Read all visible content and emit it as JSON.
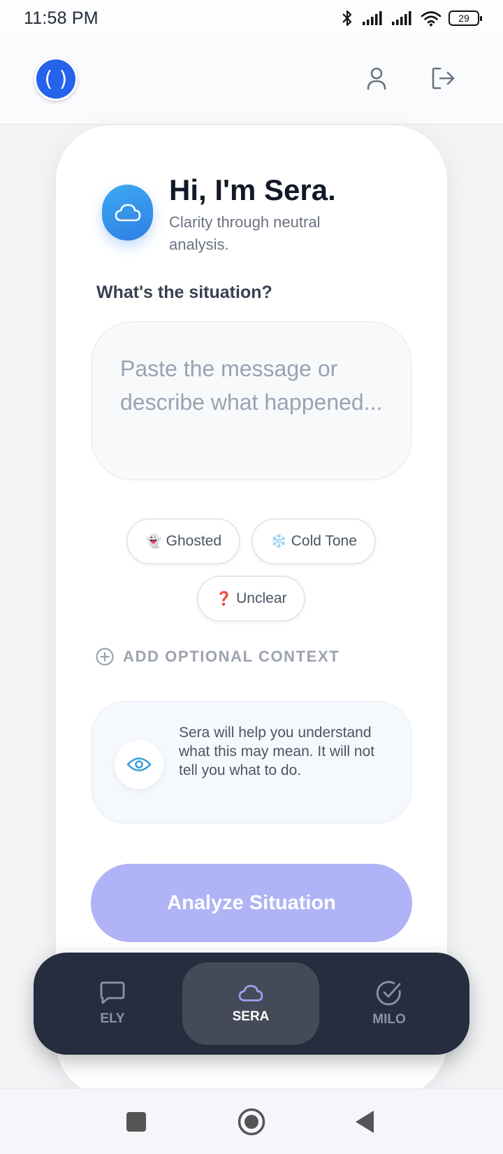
{
  "status_bar": {
    "time": "11:58 PM",
    "battery": "29",
    "icons": [
      "bluetooth-icon",
      "signal-icon",
      "signal-icon",
      "wifi-icon",
      "battery-icon"
    ]
  },
  "header": {
    "logo_text": "( )",
    "profile_icon": "user-icon",
    "logout_icon": "logout-icon"
  },
  "intro": {
    "greeting": "Hi, I'm Sera.",
    "tagline": "Clarity through neutral analysis.",
    "avatar_icon": "cloud-icon"
  },
  "form": {
    "question": "What's the situation?",
    "input_placeholder": "Paste the message or describe what happened...",
    "input_value": ""
  },
  "chips": [
    {
      "emoji": "👻",
      "label": "Ghosted"
    },
    {
      "emoji": "❄️",
      "label": "Cold Tone"
    },
    {
      "emoji": "❓",
      "label": "Unclear"
    }
  ],
  "add_context": {
    "label": "ADD OPTIONAL CONTEXT",
    "icon": "plus-circle-icon"
  },
  "info": {
    "icon": "eye-icon",
    "text": "Sera will help you understand what this may mean. It will not tell you what to do."
  },
  "analyze_button": {
    "label": "Analyze Situation",
    "color": "#b0b3f5"
  },
  "bottom_nav": {
    "items": [
      {
        "label": "ELY",
        "icon": "chat-icon",
        "active": false
      },
      {
        "label": "SERA",
        "icon": "cloud-icon",
        "active": true
      },
      {
        "label": "MILO",
        "icon": "check-circle-icon",
        "active": false
      }
    ]
  },
  "system_nav": {
    "buttons": [
      "recents-square-icon",
      "home-circle-icon",
      "back-triangle-icon"
    ]
  },
  "colors": {
    "accent_blue": "#2563eb",
    "nav_background": "#262d3f",
    "nav_active": "#454a58",
    "info_icon": "#3a9fd8"
  }
}
